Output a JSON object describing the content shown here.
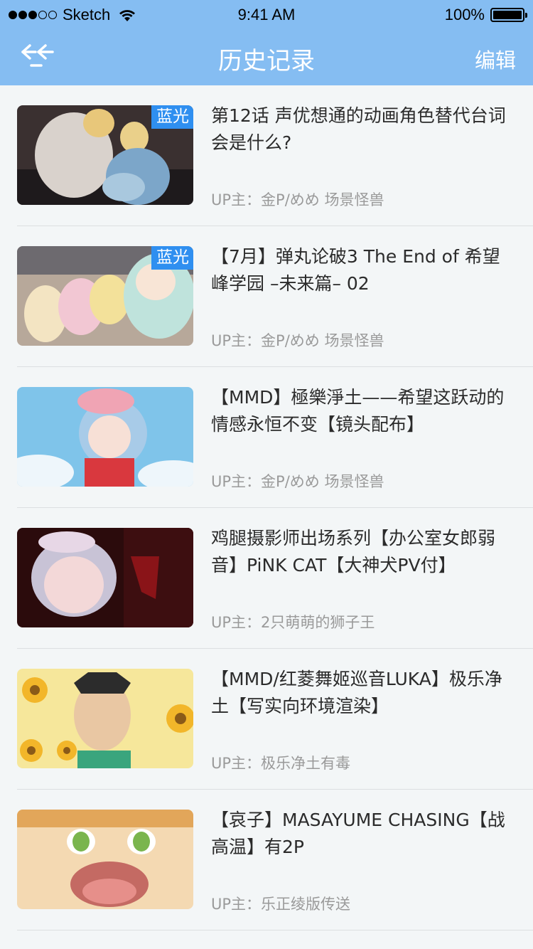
{
  "status": {
    "carrier": "Sketch",
    "time": "9:41 AM",
    "battery": "100%"
  },
  "nav": {
    "title": "历史记录",
    "edit": "编辑"
  },
  "items": [
    {
      "title": "第12话  声优想通的动画角色替代台词会是什么?",
      "uploader": "UP主：金P/めめ 场景怪兽",
      "badge": "蓝光"
    },
    {
      "title": "【7月】弹丸论破3 The End of 希望峰学园 –未来篇– 02",
      "uploader": "UP主：金P/めめ 场景怪兽",
      "badge": "蓝光"
    },
    {
      "title": "【MMD】極樂淨土——希望这跃动的情感永恒不变【镜头配布】",
      "uploader": "UP主：金P/めめ 场景怪兽",
      "badge": ""
    },
    {
      "title": "鸡腿摄影师出场系列【办公室女郎弱音】PiNK CAT【大神犬PV付】",
      "uploader": "UP主：2只萌萌的狮子王",
      "badge": ""
    },
    {
      "title": "【MMD/红菱舞姬巡音LUKA】极乐净土【写实向环境渲染】",
      "uploader": "UP主：极乐净土有毒",
      "badge": ""
    },
    {
      "title": "【哀子】MASAYUME CHASING【战高温】有2P",
      "uploader": "UP主：乐正绫版传送",
      "badge": ""
    }
  ]
}
